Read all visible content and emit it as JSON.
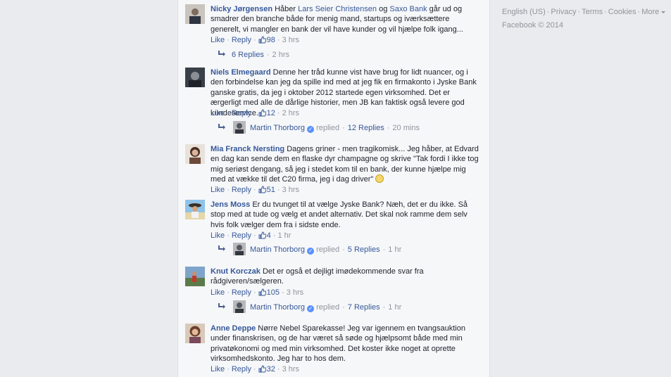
{
  "footer": {
    "language": "English (US)",
    "privacy": "Privacy",
    "terms": "Terms",
    "cookies": "Cookies",
    "more": "More",
    "copyright": "Facebook © 2014"
  },
  "actions": {
    "like": "Like",
    "reply": "Reply"
  },
  "comments": [
    {
      "author": "Nicky Jørgensen",
      "text_parts": [
        "Håber ",
        "Lars Seier Christensen",
        " og ",
        "Saxo Bank",
        " går ud og smadrer den branche både for menig mand, startups og iværksættere generelt, vi mangler en bank der vil have kunder og vil hjælpe folk igang..."
      ],
      "likes": "98",
      "time": "3 hrs",
      "replies_label": "6 Replies",
      "replies_time": "2 hrs"
    },
    {
      "author": "Niels Elmegaard",
      "text": "Denne her tråd kunne vist have brug for lidt nuancer, og i den forbindelse kan jeg da spille ind med at jeg fik en firmakonto i Jyske Bank ganske gratis, da jeg i oktober 2012 startede egen virksomhed. Det er ærgerligt med alle de dårlige historier, men JB kan faktisk også levere god kundeservice.",
      "likes": "12",
      "time": "2 hrs",
      "reply_author": "Martin Thorborg",
      "replied": "replied",
      "replies_label": "12 Replies",
      "replies_time": "20 mins"
    },
    {
      "author": "Mia Franck Nersting",
      "text": "Dagens griner - men tragikomisk... Jeg håber, at Edvard en dag kan sende dem en flaske dyr champagne og skrive \"Tak fordi I ikke tog mig seriøst dengang, så jeg i stedet kom til en bank, der kunne hjælpe mig med at vække til det C20 firma, jeg i dag driver\"",
      "likes": "51",
      "time": "3 hrs"
    },
    {
      "author": "Jens Moss",
      "text": "Er du tvunget til at vælge Jyske Bank? Næh, det er du ikke. Så stop med at tude og vælg et andet alternativ. Det skal nok ramme dem selv hvis folk vælger dem fra i sidste ende.",
      "likes": "4",
      "time": "1 hr",
      "reply_author": "Martin Thorborg",
      "replied": "replied",
      "replies_label": "5 Replies",
      "replies_time": "1 hr"
    },
    {
      "author": "Knut Korczak",
      "text": "Det er også et dejligt imødekommende svar fra rådgiveren/sælgeren.",
      "likes": "105",
      "time": "3 hrs",
      "reply_author": "Martin Thorborg",
      "replied": "replied",
      "replies_label": "7 Replies",
      "replies_time": "1 hr"
    },
    {
      "author": "Anne Deppe",
      "text": "Nørre Nebel Sparekasse! Jeg var igennem en tvangsauktion under finanskrisen, og de har været så søde og hjælpsomt både med min privatøkonomi og med min virksomhed. Det koster ikke noget at oprette virksomhedskonto. Jeg har to hos dem.",
      "likes": "32",
      "time": "3 hrs"
    }
  ]
}
